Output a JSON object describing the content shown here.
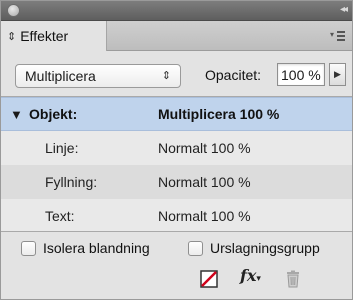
{
  "panel": {
    "tab_label": "Effekter",
    "menu_icon": "panel-menu-icon",
    "collapse_icon": "double-arrow-icon"
  },
  "blend": {
    "mode_value": "Multiplicera",
    "opacity_label": "Opacitet:",
    "opacity_value": "100 %"
  },
  "list": {
    "rows": [
      {
        "label": "Objekt:",
        "value": "Multiplicera 100 %",
        "selected": true
      },
      {
        "label": "Linje:",
        "value": "Normalt 100 %"
      },
      {
        "label": "Fyllning:",
        "value": "Normalt 100 %"
      },
      {
        "label": "Text:",
        "value": "Normalt 100 %"
      }
    ]
  },
  "options": {
    "isolate_label": "Isolera blandning",
    "knockout_label": "Urslagningsgrupp"
  },
  "toolbar": {
    "fx_label": "fx",
    "icons": [
      "clear-effects-icon",
      "fx-icon",
      "trash-icon"
    ]
  },
  "colors": {
    "selection": "#bfd3ec",
    "panel_bg": "#e3e3e3",
    "clear_icon_red": "#d0021b"
  }
}
